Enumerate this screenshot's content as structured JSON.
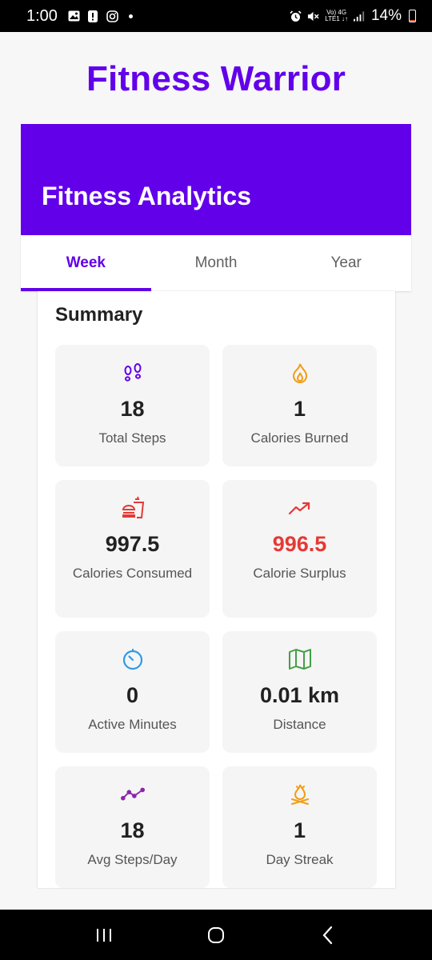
{
  "status_bar": {
    "time": "1:00",
    "network_top": "Vo) 4G",
    "network_bottom": "LTE1 ↓↑",
    "battery": "14%"
  },
  "app": {
    "title": "Fitness Warrior"
  },
  "header": {
    "title": "Fitness Analytics"
  },
  "tabs": [
    {
      "label": "Week",
      "active": true
    },
    {
      "label": "Month",
      "active": false
    },
    {
      "label": "Year",
      "active": false
    }
  ],
  "summary": {
    "title": "Summary",
    "cards": [
      {
        "icon": "footprints-icon",
        "color": "#6200ea",
        "value": "18",
        "label": "Total Steps"
      },
      {
        "icon": "flame-icon",
        "color": "#f39c12",
        "value": "1",
        "label": "Calories Burned"
      },
      {
        "icon": "fastfood-icon",
        "color": "#e53935",
        "value": "997.5",
        "label": "Calories Consumed"
      },
      {
        "icon": "trending-up-icon",
        "color": "#e53935",
        "value": "996.5",
        "label": "Calorie Surplus"
      },
      {
        "icon": "timer-icon",
        "color": "#2e9be6",
        "value": "0",
        "label": "Active Minutes"
      },
      {
        "icon": "map-icon",
        "color": "#43a047",
        "value": "0.01 km",
        "label": "Distance"
      },
      {
        "icon": "line-chart-icon",
        "color": "#8e24aa",
        "value": "18",
        "label": "Avg Steps/Day"
      },
      {
        "icon": "campfire-icon",
        "color": "#f39c12",
        "value": "1",
        "label": "Day Streak"
      }
    ]
  }
}
